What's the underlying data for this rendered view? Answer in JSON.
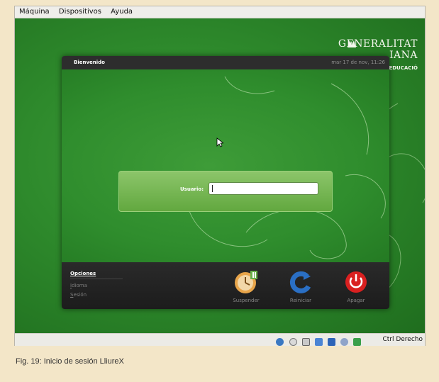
{
  "menubar": {
    "items": [
      "Máquina",
      "Dispositivos",
      "Ayuda"
    ]
  },
  "branding": {
    "line1": "GENERALITAT",
    "line2": "IANA",
    "line3": "CONSELLERIA D'EDUCACIÓ"
  },
  "gdm": {
    "title": "Bienvenido",
    "clock": "mar 17 de nov, 11:26",
    "login_label": "Usuario:",
    "login_value": "",
    "options": {
      "heading": "Opciones",
      "items": [
        "Idioma",
        "Sesión"
      ]
    },
    "actions": {
      "suspend": "Suspender",
      "restart": "Reiniciar",
      "shutdown": "Apagar"
    }
  },
  "statusbar": {
    "host_key": "Ctrl Derecho",
    "icons": [
      "hard-disk-icon",
      "cd-icon",
      "floppy-icon",
      "network-icon",
      "usb-icon",
      "shared-folder-icon",
      "mouse-integration-icon"
    ]
  },
  "caption": "Fig. 19: Inicio de sesión LliureX",
  "colors": {
    "desktop_green": "#2e8a2c",
    "panel_dark": "#2d2d2d",
    "login_box_green": "#7ab955",
    "shutdown_red": "#d92020",
    "restart_blue": "#2a6fc4"
  }
}
